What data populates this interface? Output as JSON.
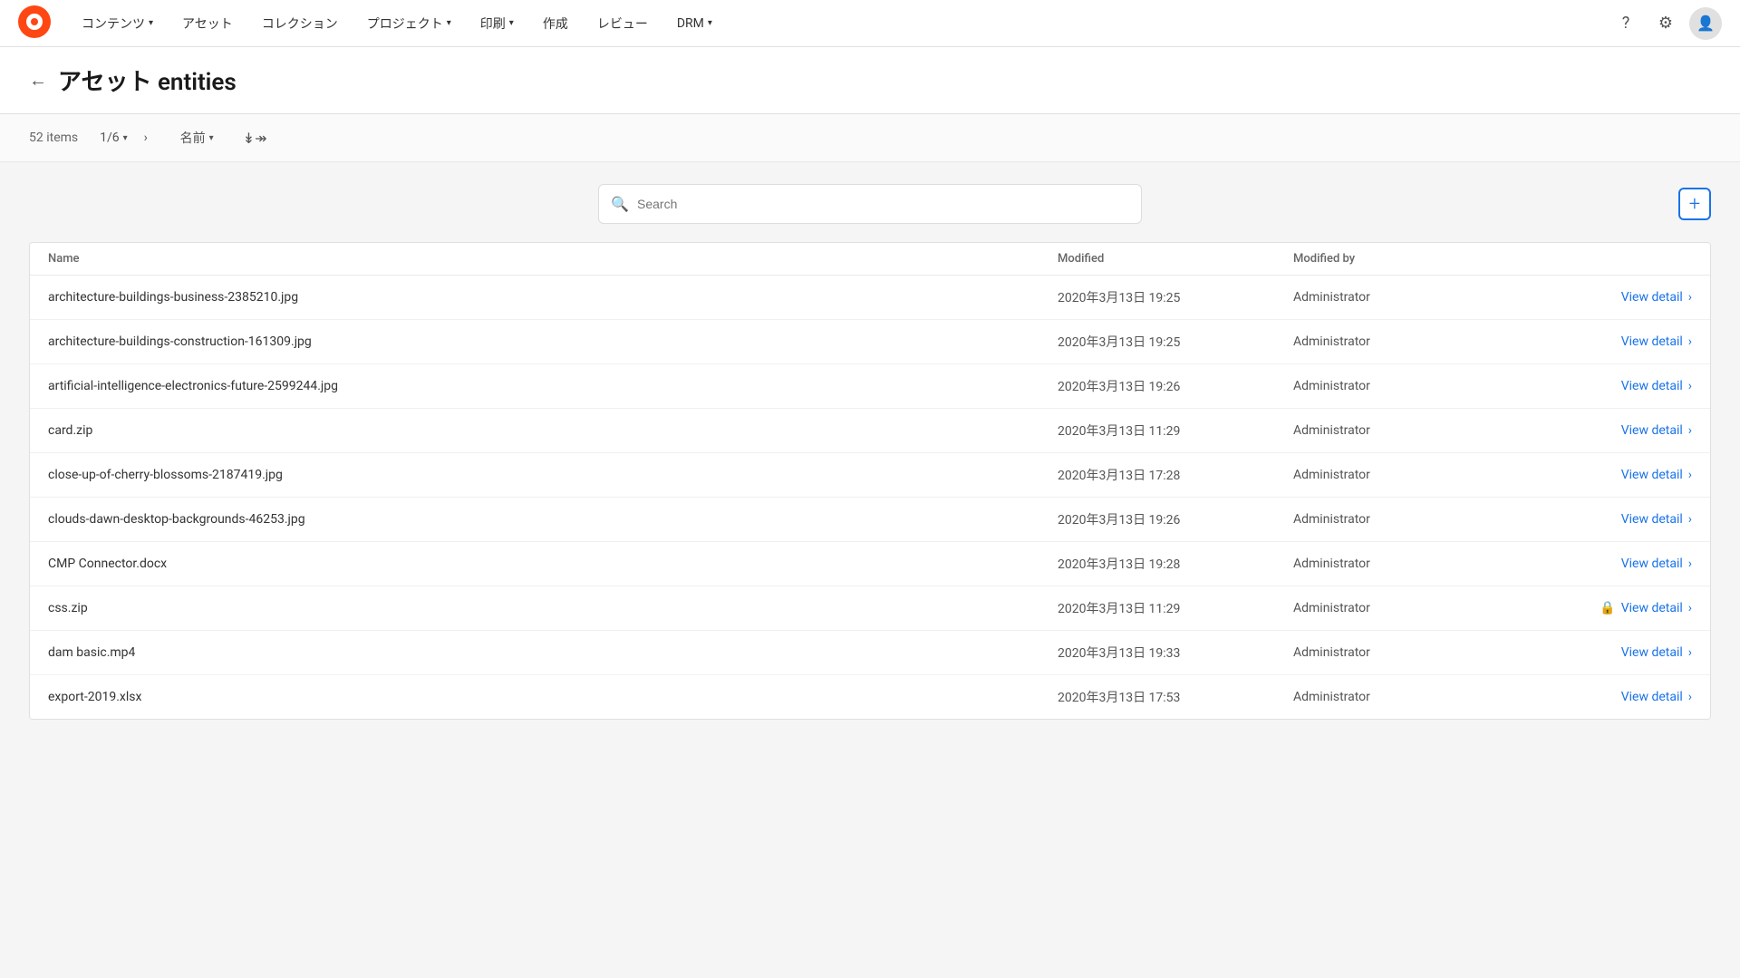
{
  "app": {
    "logo_alt": "Contentstack logo"
  },
  "topnav": {
    "items": [
      {
        "id": "contents",
        "label": "コンテンツ",
        "has_dropdown": true
      },
      {
        "id": "assets",
        "label": "アセット",
        "has_dropdown": false
      },
      {
        "id": "collections",
        "label": "コレクション",
        "has_dropdown": false
      },
      {
        "id": "projects",
        "label": "プロジェクト",
        "has_dropdown": true
      },
      {
        "id": "print",
        "label": "印刷",
        "has_dropdown": true
      },
      {
        "id": "create",
        "label": "作成",
        "has_dropdown": false
      },
      {
        "id": "review",
        "label": "レビュー",
        "has_dropdown": false
      },
      {
        "id": "drm",
        "label": "DRM",
        "has_dropdown": true
      }
    ]
  },
  "page_header": {
    "back_label": "←",
    "title": "アセット entities"
  },
  "toolbar": {
    "items_count": "52 items",
    "page_current": "1/6",
    "sort_label": "名前",
    "sort_icon": "⇅"
  },
  "search": {
    "placeholder": "Search",
    "add_label": "+"
  },
  "table": {
    "columns": {
      "name": "Name",
      "modified": "Modified",
      "modified_by": "Modified by",
      "action": ""
    },
    "rows": [
      {
        "name": "architecture-buildings-business-2385210.jpg",
        "modified": "2020年3月13日 19:25",
        "modified_by": "Administrator",
        "action_label": "View detail",
        "has_lock": false
      },
      {
        "name": "architecture-buildings-construction-161309.jpg",
        "modified": "2020年3月13日 19:25",
        "modified_by": "Administrator",
        "action_label": "View detail",
        "has_lock": false
      },
      {
        "name": "artificial-intelligence-electronics-future-2599244.jpg",
        "modified": "2020年3月13日 19:26",
        "modified_by": "Administrator",
        "action_label": "View detail",
        "has_lock": false
      },
      {
        "name": "card.zip",
        "modified": "2020年3月13日 11:29",
        "modified_by": "Administrator",
        "action_label": "View detail",
        "has_lock": false
      },
      {
        "name": "close-up-of-cherry-blossoms-2187419.jpg",
        "modified": "2020年3月13日 17:28",
        "modified_by": "Administrator",
        "action_label": "View detail",
        "has_lock": false
      },
      {
        "name": "clouds-dawn-desktop-backgrounds-46253.jpg",
        "modified": "2020年3月13日 19:26",
        "modified_by": "Administrator",
        "action_label": "View detail",
        "has_lock": false
      },
      {
        "name": "CMP Connector.docx",
        "modified": "2020年3月13日 19:28",
        "modified_by": "Administrator",
        "action_label": "View detail",
        "has_lock": false
      },
      {
        "name": "css.zip",
        "modified": "2020年3月13日 11:29",
        "modified_by": "Administrator",
        "action_label": "View detail",
        "has_lock": true
      },
      {
        "name": "dam basic.mp4",
        "modified": "2020年3月13日 19:33",
        "modified_by": "Administrator",
        "action_label": "View detail",
        "has_lock": false
      },
      {
        "name": "export-2019.xlsx",
        "modified": "2020年3月13日 17:53",
        "modified_by": "Administrator",
        "action_label": "View detail",
        "has_lock": false
      }
    ]
  },
  "colors": {
    "accent": "#1a73e8",
    "logo_orange": "#FF4713"
  }
}
